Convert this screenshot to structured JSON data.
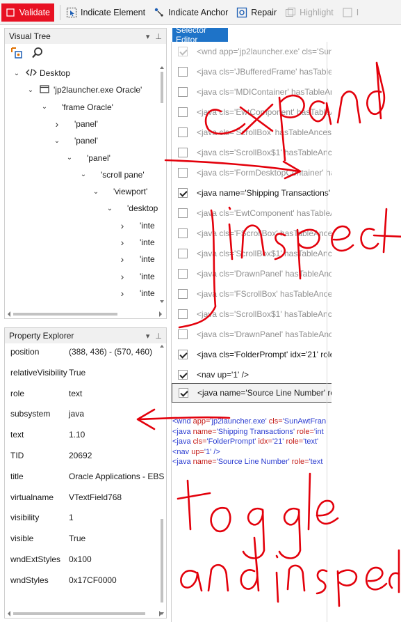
{
  "toolbar": {
    "validate": "Validate",
    "indicate_element": "Indicate Element",
    "indicate_anchor": "Indicate Anchor",
    "repair": "Repair",
    "highlight": "Highlight",
    "cut": "I"
  },
  "visual_tree": {
    "title": "Visual Tree",
    "nodes": [
      {
        "label": "Desktop",
        "chev": "expanded",
        "icon": "code-icon"
      },
      {
        "label": "'jp2launcher.exe Oracle'",
        "chev": "expanded",
        "icon": "window-icon"
      },
      {
        "label": "'frame Oracle'",
        "chev": "expanded"
      },
      {
        "label": "'panel'",
        "chev": "collapsed"
      },
      {
        "label": "'panel'",
        "chev": "expanded"
      },
      {
        "label": "'panel'",
        "chev": "expanded"
      },
      {
        "label": "'scroll pane'",
        "chev": "expanded"
      },
      {
        "label": "'viewport'",
        "chev": "expanded"
      },
      {
        "label": "'desktop",
        "chev": "expanded"
      },
      {
        "label": "'inte",
        "chev": "collapsed"
      },
      {
        "label": "'inte",
        "chev": "collapsed"
      },
      {
        "label": "'inte",
        "chev": "collapsed"
      },
      {
        "label": "'inte",
        "chev": "collapsed"
      },
      {
        "label": "'inte",
        "chev": "collapsed"
      },
      {
        "label": "'inte",
        "chev": "collapsed"
      }
    ]
  },
  "property_explorer": {
    "title": "Property Explorer",
    "properties": [
      {
        "name": "position",
        "value": "(388, 436) - (570, 460)"
      },
      {
        "name": "relativeVisibility",
        "value": "True"
      },
      {
        "name": "role",
        "value": "text"
      },
      {
        "name": "subsystem",
        "value": "java"
      },
      {
        "name": "text",
        "value": "1.10"
      },
      {
        "name": "TID",
        "value": "20692"
      },
      {
        "name": "title",
        "value": "Oracle Applications - EBS"
      },
      {
        "name": "virtualname",
        "value": "VTextField768"
      },
      {
        "name": "visibility",
        "value": "1"
      },
      {
        "name": "visible",
        "value": "True"
      },
      {
        "name": "wndExtStyles",
        "value": "0x100"
      },
      {
        "name": "wndStyles",
        "value": "0x17CF0000"
      }
    ]
  },
  "selector_editor": {
    "tab": "Selector Editor",
    "rows": [
      {
        "text": "<wnd app='jp2launcher.exe' cls='SunA",
        "checked": true,
        "disabled": true
      },
      {
        "text": "<java cls='JBufferedFrame' hasTableAn",
        "checked": false
      },
      {
        "text": "<java cls='MDIContainer' hasTableAnc",
        "checked": false
      },
      {
        "text": "<java cls='EwtComponent' hasTableAn",
        "checked": false
      },
      {
        "text": "<java cls='ScrollBox' hasTableAncesto",
        "checked": false
      },
      {
        "text": "<java cls='ScrollBox$1' hasTableAnces",
        "checked": false
      },
      {
        "text": "<java cls='FormDesktopContainer' has",
        "checked": false
      },
      {
        "text": "<java name='Shipping Transactions' ro",
        "checked": true
      },
      {
        "text": "<java cls='EwtComponent' hasTableAn",
        "checked": false
      },
      {
        "text": "<java cls='FScrollBox' hasTableAncest",
        "checked": false
      },
      {
        "text": "<java cls='ScrollBox$1' hasTableAnces",
        "checked": false
      },
      {
        "text": "<java cls='DrawnPanel' hasTableAnces",
        "checked": false
      },
      {
        "text": "<java cls='FScrollBox' hasTableAncesto",
        "checked": false
      },
      {
        "text": "<java cls='ScrollBox$1' hasTableAnces",
        "checked": false
      },
      {
        "text": "<java cls='DrawnPanel' hasTableAnces",
        "checked": false
      },
      {
        "text": "<java cls='FolderPrompt' idx='21' role",
        "checked": true
      },
      {
        "text": "<nav up='1' />",
        "checked": true
      },
      {
        "text": "<java name='Source Line Number' rol",
        "checked": true,
        "highlight": true
      }
    ],
    "xml": [
      {
        "open": "<wnd ",
        "attrs": [
          [
            "app=",
            "'jp2launcher.exe' "
          ],
          [
            "cls=",
            "'SunAwtFran"
          ]
        ],
        "close": ""
      },
      {
        "open": "<java ",
        "attrs": [
          [
            "name=",
            "'Shipping Transactions' "
          ],
          [
            "role=",
            "'int"
          ]
        ],
        "close": ""
      },
      {
        "open": "<java ",
        "attrs": [
          [
            "cls=",
            "'FolderPrompt' "
          ],
          [
            "idx=",
            "'21' "
          ],
          [
            "role=",
            "'text'"
          ]
        ],
        "close": ""
      },
      {
        "open": "<nav ",
        "attrs": [
          [
            "up=",
            "'1' "
          ]
        ],
        "close": "/>"
      },
      {
        "open": "<java ",
        "attrs": [
          [
            "name=",
            "'Source Line Number' "
          ],
          [
            "role=",
            "'text"
          ]
        ],
        "close": ""
      }
    ]
  },
  "annotations": {
    "words": [
      "expand",
      "inspect",
      "toggle",
      "and inspect"
    ],
    "color": "#e3000b"
  }
}
